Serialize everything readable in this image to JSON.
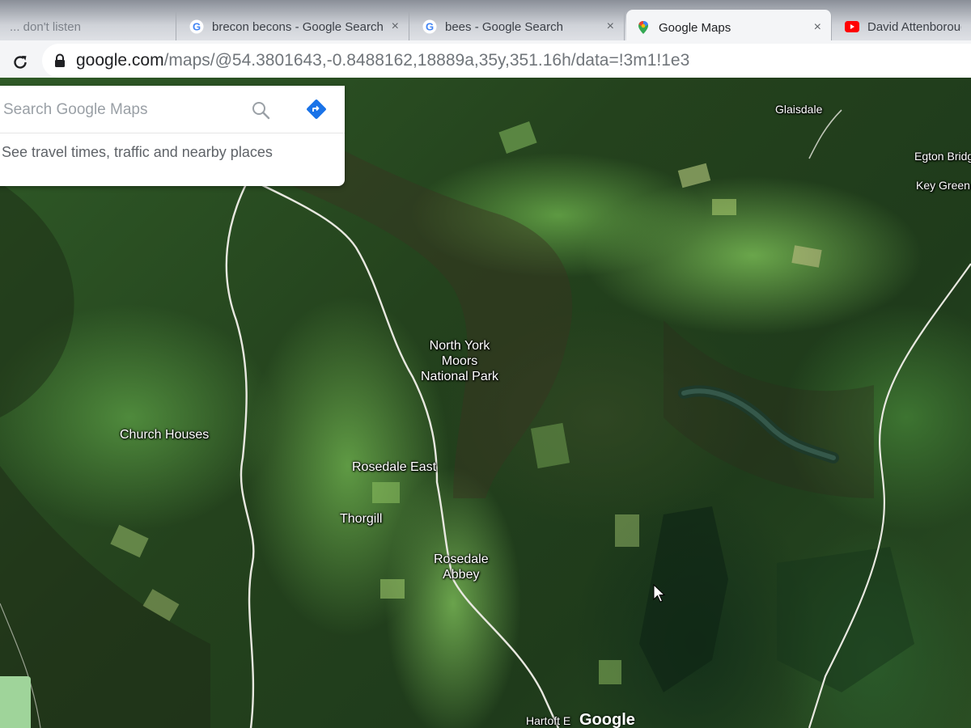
{
  "browser": {
    "tabs": [
      {
        "title": "... don't listen",
        "favicon": "generic-favicon",
        "active": false
      },
      {
        "title": "brecon becons - Google Search",
        "favicon": "google-g-icon",
        "active": false
      },
      {
        "title": "bees - Google Search",
        "favicon": "google-g-icon",
        "active": false
      },
      {
        "title": "Google Maps",
        "favicon": "google-maps-pin-icon",
        "active": true
      },
      {
        "title": "David Attenborough On",
        "favicon": "youtube-icon",
        "active": false
      }
    ],
    "close_glyph": "×",
    "address": {
      "host": "google.com",
      "path": "/maps/@54.3801643,-0.8488162,18889a,35y,351.16h/data=!3m1!1e3"
    }
  },
  "maps": {
    "search": {
      "placeholder": "Search Google Maps",
      "hint": "See travel times, traffic and nearby places"
    },
    "places": {
      "glaisdale": "Glaisdale",
      "egton_bridge": "Egton Bridg",
      "key_green": "Key Green",
      "national_park": [
        "North York",
        "Moors",
        "National Park"
      ],
      "church_houses": "Church Houses",
      "rosedale_east": "Rosedale East",
      "thorgill": "Thorgill",
      "rosedale_abbey": [
        "Rosedale",
        "Abbey"
      ],
      "hartoft": "Hartoft E"
    },
    "logo": "Google",
    "view_mode": "satellite"
  },
  "colors": {
    "maps_blue": "#1a73e8",
    "youtube_red": "#ff0000",
    "road": "#e8e8e0"
  }
}
